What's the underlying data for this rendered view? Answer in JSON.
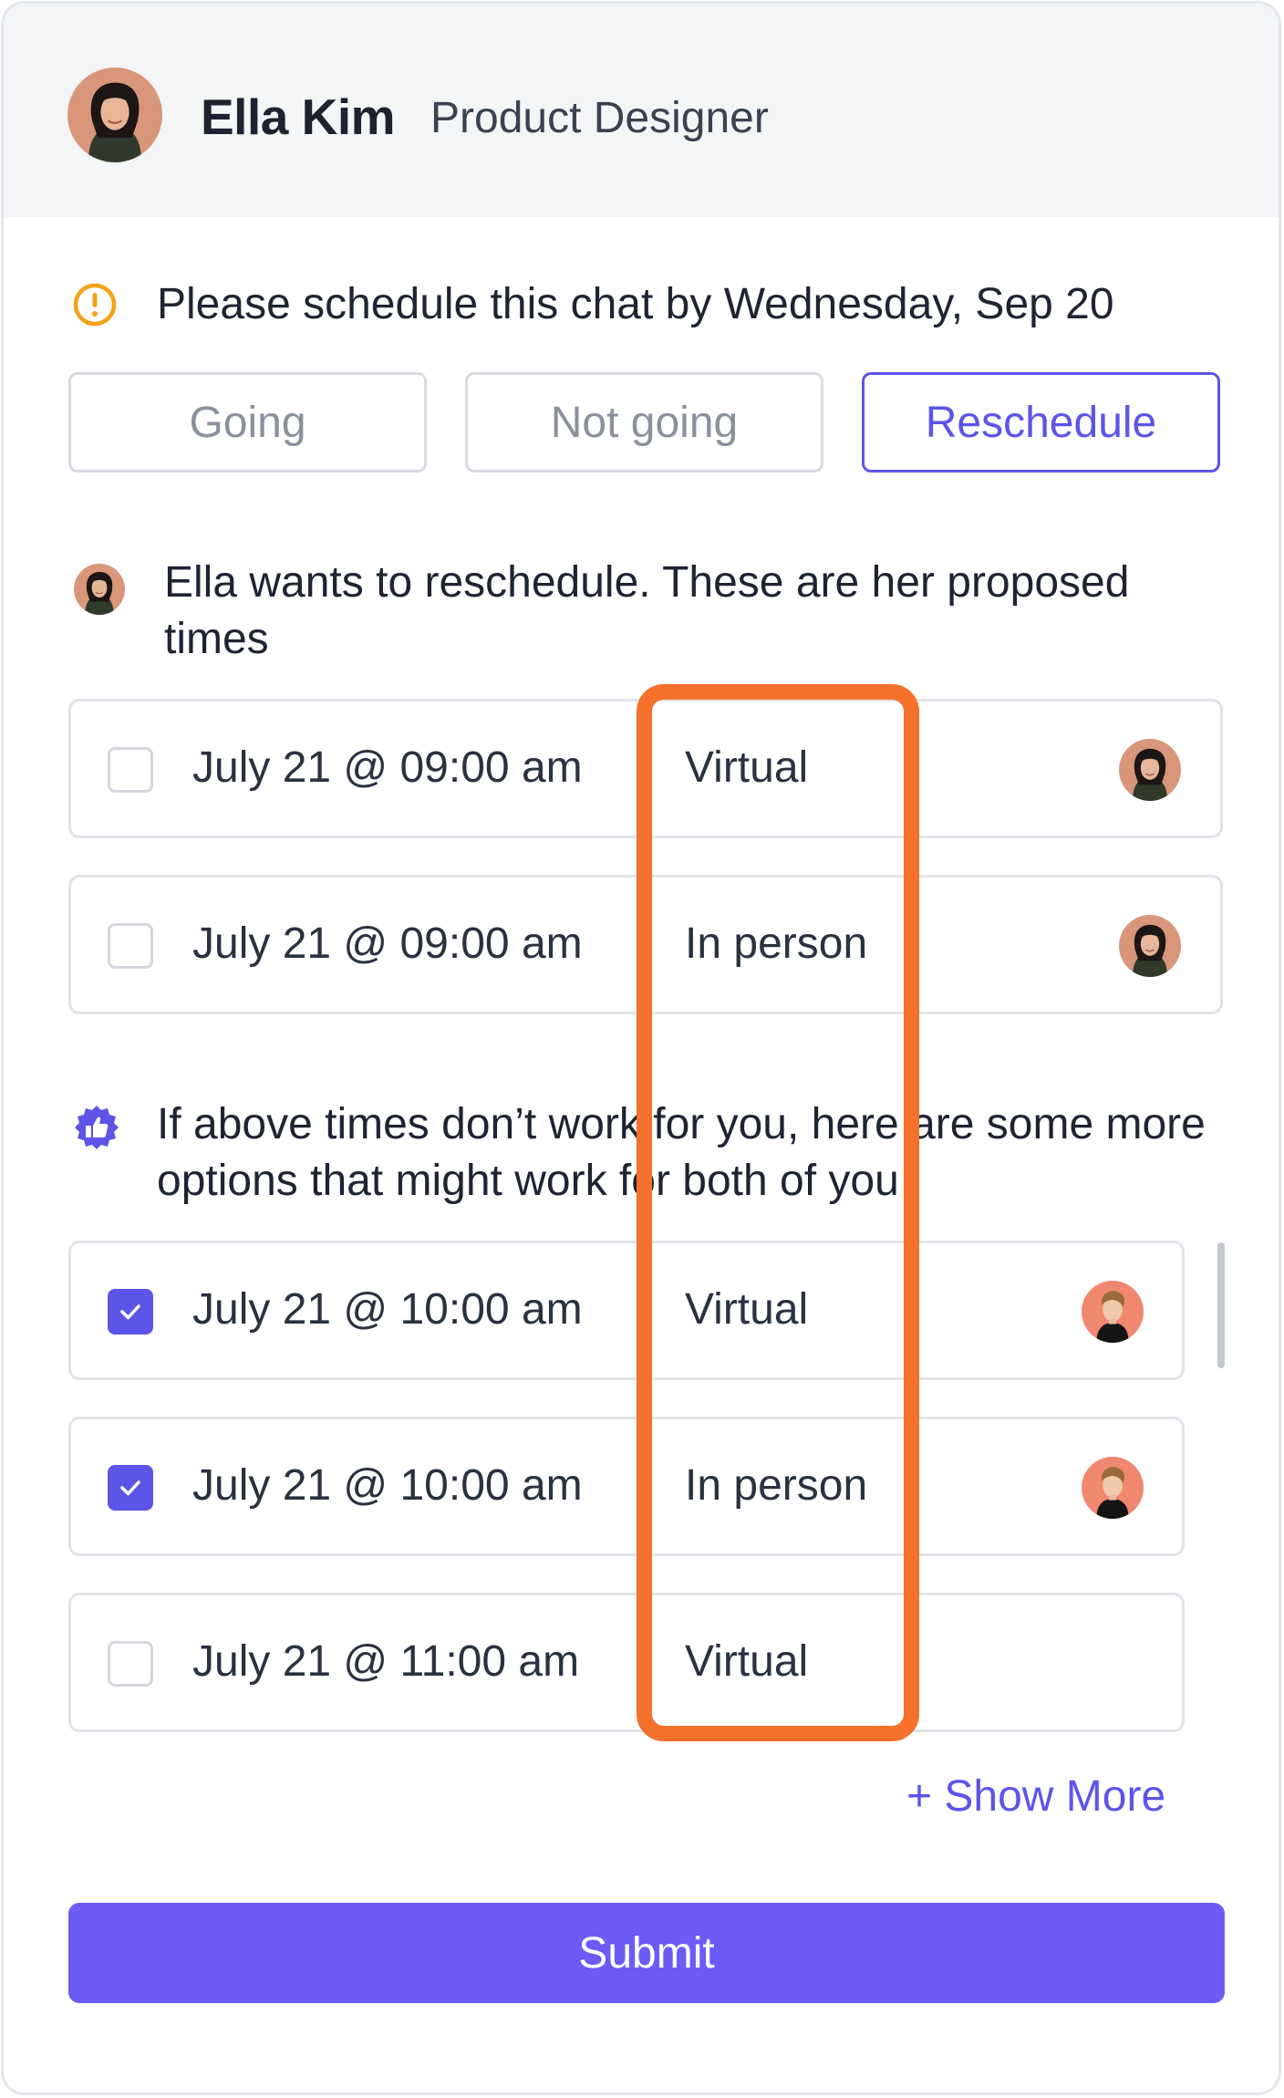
{
  "header": {
    "name": "Ella Kim",
    "role": "Product Designer"
  },
  "notice": {
    "icon": "alert-circle-icon",
    "text": "Please schedule this chat by Wednesday, Sep 20"
  },
  "rsvp": {
    "going": "Going",
    "not_going": "Not going",
    "reschedule": "Reschedule",
    "active": "Reschedule"
  },
  "proposal": {
    "text": "Ella wants to reschedule. These are her proposed times",
    "slots": [
      {
        "time": "July 21 @ 09:00 am",
        "mode": "Virtual",
        "checked": false,
        "avatar": "ella-avatar"
      },
      {
        "time": "July 21 @ 09:00 am",
        "mode": "In person",
        "checked": false,
        "avatar": "ella-avatar"
      }
    ]
  },
  "suggestions": {
    "icon": "thumbs-up-badge-icon",
    "text": "If above times don’t work for you, here are some more options that might work for both of you",
    "slots": [
      {
        "time": "July 21 @ 10:00 am",
        "mode": "Virtual",
        "checked": true,
        "avatar": "participant-avatar"
      },
      {
        "time": "July 21 @ 10:00 am",
        "mode": "In person",
        "checked": true,
        "avatar": "participant-avatar"
      },
      {
        "time": "July 21 @ 11:00 am",
        "mode": "Virtual",
        "checked": false,
        "avatar": ""
      }
    ],
    "show_more": "+ Show More"
  },
  "submit_label": "Submit",
  "colors": {
    "accent": "#5d54e8",
    "submit": "#6a5cf5",
    "highlight": "#f5702a",
    "warning": "#f5a21b",
    "header_bg": "#f4f5f7"
  }
}
